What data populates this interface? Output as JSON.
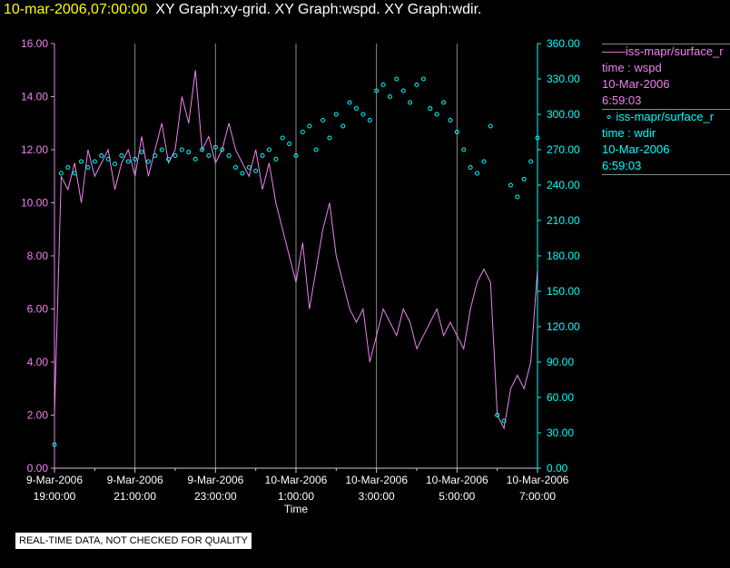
{
  "title": {
    "timestamp": "10-mar-2006,07:00:00",
    "graphs": "XY Graph:xy-grid.  XY Graph:wspd.  XY Graph:wdir."
  },
  "legend": [
    {
      "marker": "line",
      "name": "iss-mapr/surface_r",
      "line2": "time : wspd",
      "line3": "10-Mar-2006",
      "line4": "6:59:03",
      "color": "#ee82ee"
    },
    {
      "marker": "circle",
      "name": "iss-mapr/surface_r",
      "line2": "time : wdir",
      "line3": "10-Mar-2006",
      "line4": "6:59:03",
      "color": "#00ffff"
    }
  ],
  "note": "REAL-TIME DATA, NOT CHECKED FOR QUALITY",
  "chart_data": {
    "type": "line+scatter",
    "xlabel": "Time",
    "x_unit": "hours since 9-Mar-2006 19:00:00",
    "x_step_hours": 0.16667,
    "xlim": [
      0,
      12
    ],
    "xticks": [
      {
        "d": "9-Mar-2006",
        "t": "19:00:00"
      },
      {
        "d": "9-Mar-2006",
        "t": "21:00:00"
      },
      {
        "d": "9-Mar-2006",
        "t": "23:00:00"
      },
      {
        "d": "10-Mar-2006",
        "t": "1:00:00"
      },
      {
        "d": "10-Mar-2006",
        "t": "3:00:00"
      },
      {
        "d": "10-Mar-2006",
        "t": "5:00:00"
      },
      {
        "d": "10-Mar-2006",
        "t": "7:00:00"
      }
    ],
    "y_left": {
      "ylim": [
        0,
        16
      ],
      "ticks": [
        "0.00",
        "2.00",
        "4.00",
        "6.00",
        "8.00",
        "10.00",
        "12.00",
        "14.00",
        "16.00"
      ],
      "color": "#ee82ee"
    },
    "y_right": {
      "ylim": [
        0,
        360
      ],
      "ticks": [
        "0.00",
        "30.00",
        "60.00",
        "90.00",
        "120.00",
        "150.00",
        "180.00",
        "210.00",
        "240.00",
        "270.00",
        "300.00",
        "330.00",
        "360.00"
      ],
      "color": "#00ffff"
    },
    "grid": "vertical",
    "series": [
      {
        "name": "wspd",
        "style": "line",
        "axis": "left",
        "color": "#ee82ee",
        "values": [
          2,
          11,
          10.5,
          11.5,
          10,
          12,
          11,
          11.5,
          12,
          10.5,
          11.5,
          12,
          11,
          12.5,
          11,
          12,
          13,
          11.5,
          12,
          14,
          13,
          15,
          12,
          12.5,
          11.5,
          12,
          13,
          12,
          11.5,
          11,
          12,
          10.5,
          11.5,
          10,
          9,
          8,
          7,
          8.5,
          6,
          7.5,
          9,
          10,
          8,
          7,
          6,
          5.5,
          6,
          4,
          5,
          6,
          5.5,
          5,
          6,
          5.5,
          4.5,
          5,
          5.5,
          6,
          5,
          5.5,
          5,
          4.5,
          6,
          7,
          7.5,
          7,
          2,
          1.5,
          3,
          3.5,
          3,
          4,
          7.5
        ]
      },
      {
        "name": "wdir",
        "style": "scatter",
        "axis": "right",
        "color": "#00ffff",
        "values": [
          20,
          250,
          255,
          250,
          260,
          255,
          260,
          265,
          262,
          258,
          265,
          260,
          262,
          268,
          260,
          265,
          270,
          262,
          265,
          270,
          268,
          262,
          270,
          265,
          272,
          270,
          265,
          255,
          250,
          255,
          252,
          265,
          270,
          262,
          280,
          275,
          265,
          285,
          290,
          270,
          295,
          280,
          300,
          290,
          310,
          305,
          300,
          295,
          320,
          325,
          315,
          330,
          320,
          310,
          325,
          330,
          305,
          300,
          310,
          295,
          285,
          270,
          255,
          250,
          260,
          290,
          45,
          40,
          240,
          230,
          245,
          260,
          280
        ]
      }
    ]
  }
}
